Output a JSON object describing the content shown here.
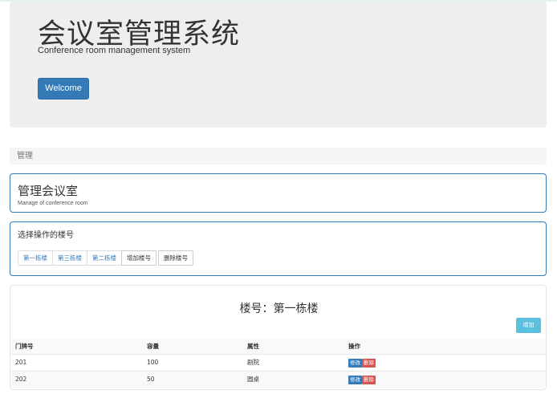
{
  "header": {
    "title": "会议室管理系统",
    "subtitle": "Conference room management system",
    "welcome_button": "Welcome"
  },
  "breadcrumb": "管理",
  "manage_panel": {
    "title": "管理会议室",
    "subtitle": "Manage of conference room"
  },
  "select_panel": {
    "title": "选择操作的楼号",
    "buildings": [
      "第一栋楼",
      "第三栋楼",
      "第二栋楼"
    ],
    "add_building": "增加楼号",
    "delete_building": "删除楼号"
  },
  "room_table": {
    "title": "楼号：第一栋楼",
    "add_button": "增加",
    "columns": [
      "门牌号",
      "容量",
      "属性",
      "操作"
    ],
    "rows": [
      {
        "number": "201",
        "capacity": "100",
        "type": "剧院",
        "edit": "修改",
        "delete": "删除"
      },
      {
        "number": "202",
        "capacity": "50",
        "type": "圆桌",
        "edit": "修改",
        "delete": "删除"
      }
    ]
  },
  "colors": {
    "primary": "#337ab7",
    "info": "#5bc0de",
    "danger": "#d9534f",
    "jumbotron_bg": "#eeeeee"
  }
}
